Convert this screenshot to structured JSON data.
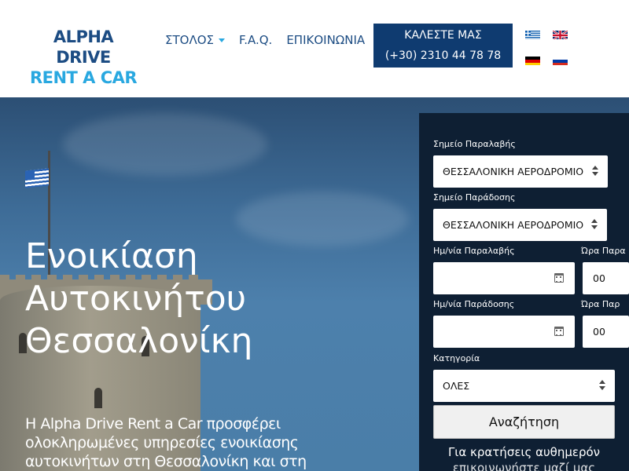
{
  "brand": {
    "line1": "ALPHA DRIVE",
    "line2": "RENT A CAR"
  },
  "nav": {
    "fleet": "ΣΤΟΛΟΣ",
    "faq": "F.A.Q.",
    "contact": "ΕΠΙΚΟΙΝΩΝΙΑ"
  },
  "call": {
    "label": "ΚΑΛΕΣΤΕ ΜΑΣ",
    "phone": "(+30) 2310 44 78 78"
  },
  "languages": [
    "greek-flag-icon",
    "uk-flag-icon",
    "german-flag-icon",
    "russian-flag-icon"
  ],
  "hero": {
    "title_line1": "Ενοικίαση",
    "title_line2": "Αυτοκινήτου",
    "title_line3": "Θεσσαλονίκη",
    "text_line1": "Η Alpha Drive Rent a Car προσφέρει",
    "text_line2": "ολοκληρωμένες υπηρεσίες ενοικίασης",
    "text_line3": "αυτοκινήτων στη Θεσσαλονίκη και στη"
  },
  "booking": {
    "pickup_location_label": "Σημείο Παραλαβής",
    "pickup_location_value": "ΘΕΣΣΑΛΟΝΙΚΗ ΑΕΡΟΔΡΟΜΙΟ",
    "dropoff_location_label": "Σημείο Παράδοσης",
    "dropoff_location_value": "ΘΕΣΣΑΛΟΝΙΚΗ ΑΕΡΟΔΡΟΜΙΟ",
    "pickup_date_label": "Ημ/νία Παραλαβής",
    "pickup_time_label": "Ώρα Παρα",
    "pickup_hour": "00",
    "dropoff_date_label": "Ημ/νία Παράδοσης",
    "dropoff_time_label": "Ώρα Παρ",
    "dropoff_hour": "00",
    "category_label": "Κατηγορία",
    "category_value": "ΟΛΕΣ",
    "search_button": "Αναζήτηση",
    "note_line1": "Για κρατήσεις αυθημερόν",
    "note_line2": "επικοινωνήστε μαζί μας"
  },
  "colors": {
    "brand_dark": "#1c4c83",
    "brand_light": "#29a8e0",
    "call_bg": "#0f3b70",
    "panel_bg": "#0e1f33"
  }
}
